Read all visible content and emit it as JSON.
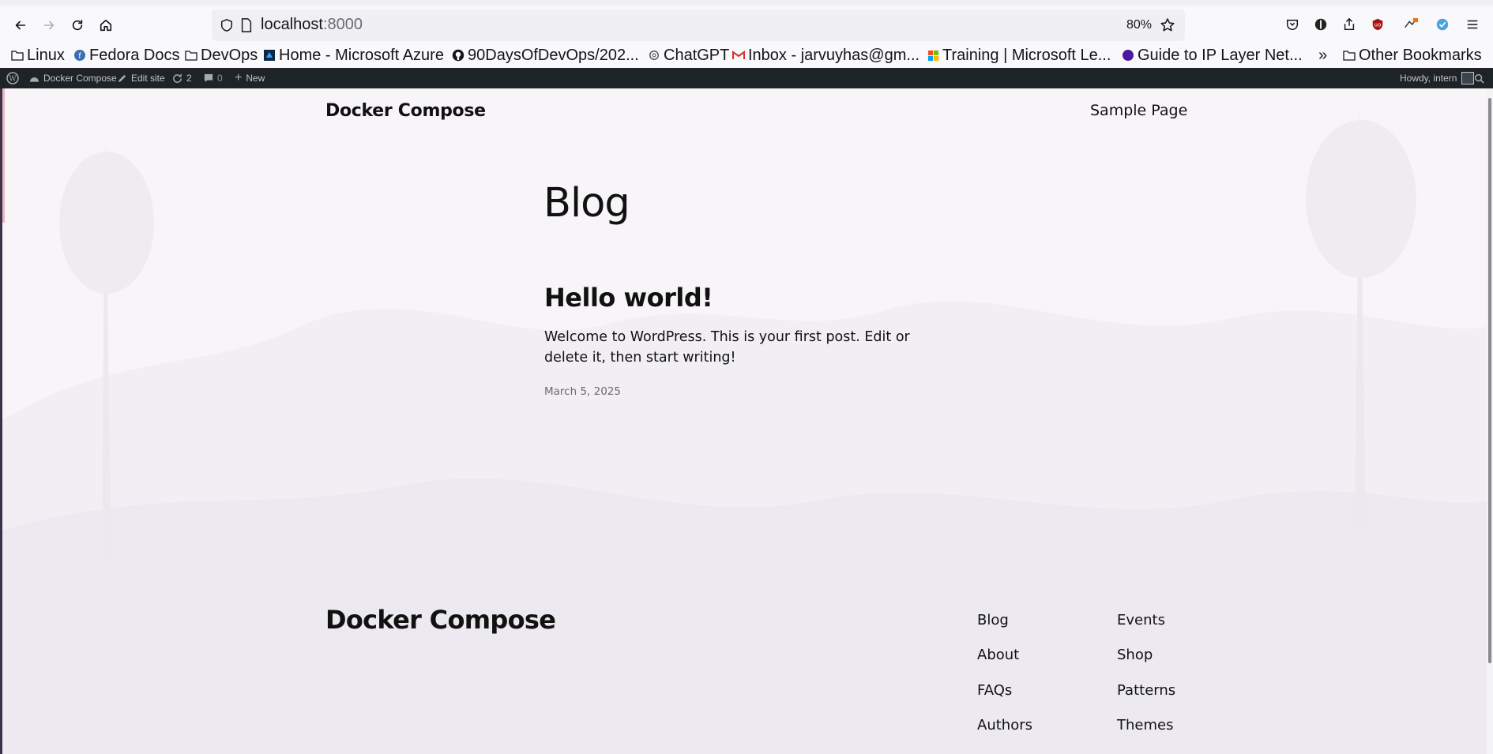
{
  "browser": {
    "url_host": "localhost",
    "url_port": ":8000",
    "zoom": "80%",
    "icons": [
      "back-icon",
      "forward-icon",
      "reload-icon",
      "home-icon",
      "shield-icon",
      "page-icon",
      "star-icon",
      "pocket-icon",
      "extension-icons",
      "menu-icon"
    ]
  },
  "bookmarks": [
    {
      "label": "Linux",
      "icon": "folder-icon"
    },
    {
      "label": "Fedora Docs",
      "icon": "fedora-icon"
    },
    {
      "label": "DevOps",
      "icon": "folder-icon"
    },
    {
      "label": "Home - Microsoft Azure",
      "icon": "azure-icon"
    },
    {
      "label": "90DaysOfDevOps/202...",
      "icon": "github-icon"
    },
    {
      "label": "ChatGPT",
      "icon": "chatgpt-icon"
    },
    {
      "label": "Inbox - jarvuyhas@gm...",
      "icon": "gmail-icon"
    },
    {
      "label": "Training | Microsoft Le...",
      "icon": "microsoft-icon"
    },
    {
      "label": "Guide to IP Layer Net...",
      "icon": "globe-icon"
    },
    {
      "label": "Other Bookmarks",
      "icon": "folder-icon"
    }
  ],
  "admin_bar": {
    "site_name": "Docker Compose",
    "edit_site": "Edit site",
    "updates_count": "2",
    "comments_count": "0",
    "new_label": "New",
    "howdy": "Howdy, intern"
  },
  "site": {
    "title": "Docker Compose",
    "nav": [
      "Sample Page"
    ]
  },
  "main": {
    "heading": "Blog",
    "post": {
      "title": "Hello world!",
      "excerpt": "Welcome to WordPress. This is your first post. Edit or delete it, then start writing!",
      "date": "March 5, 2025"
    }
  },
  "footer": {
    "title": "Docker Compose",
    "col1": [
      "Blog",
      "About",
      "FAQs",
      "Authors"
    ],
    "col2": [
      "Events",
      "Shop",
      "Patterns",
      "Themes"
    ]
  }
}
